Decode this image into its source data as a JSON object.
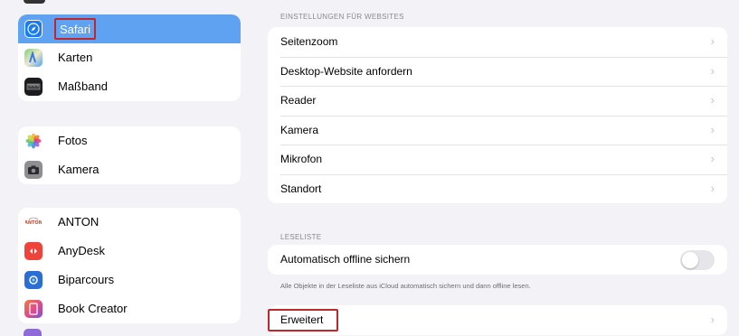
{
  "sidebar": {
    "group1": [
      {
        "label": "Safari",
        "icon": "safari-compass-icon",
        "color": "#1a7cf0",
        "selected": true
      },
      {
        "label": "Karten",
        "icon": "maps-icon",
        "color": "#5ac46a"
      },
      {
        "label": "Maßband",
        "icon": "measure-icon",
        "color": "#1c1c1e"
      }
    ],
    "group2": [
      {
        "label": "Fotos",
        "icon": "photos-flower-icon",
        "color": "#ffffff"
      },
      {
        "label": "Kamera",
        "icon": "camera-icon",
        "color": "#8e8e93"
      }
    ],
    "group3": [
      {
        "label": "ANTON",
        "icon": "anton-logo-icon",
        "color": "#ffffff"
      },
      {
        "label": "AnyDesk",
        "icon": "anydesk-icon",
        "color": "#ef443b"
      },
      {
        "label": "Biparcours",
        "icon": "biparcours-icon",
        "color": "#2a6fd6"
      },
      {
        "label": "Book Creator",
        "icon": "book-creator-icon",
        "color": "#e04e8a"
      }
    ],
    "selected_color": "#5ea2f1"
  },
  "main": {
    "website_settings": {
      "header": "EINSTELLUNGEN FÜR WEBSITES",
      "rows": [
        "Seitenzoom",
        "Desktop-Website anfordern",
        "Reader",
        "Kamera",
        "Mikrofon",
        "Standort"
      ]
    },
    "reading_list": {
      "header": "LESELISTE",
      "toggle_label": "Automatisch offline sichern",
      "toggle_on": false,
      "footnote": "Alle Objekte in der Leseliste aus iCloud automatisch sichern und dann offline lesen."
    },
    "advanced": {
      "label": "Erweitert"
    },
    "chevron": "›",
    "highlight_color": "#c0272d"
  }
}
